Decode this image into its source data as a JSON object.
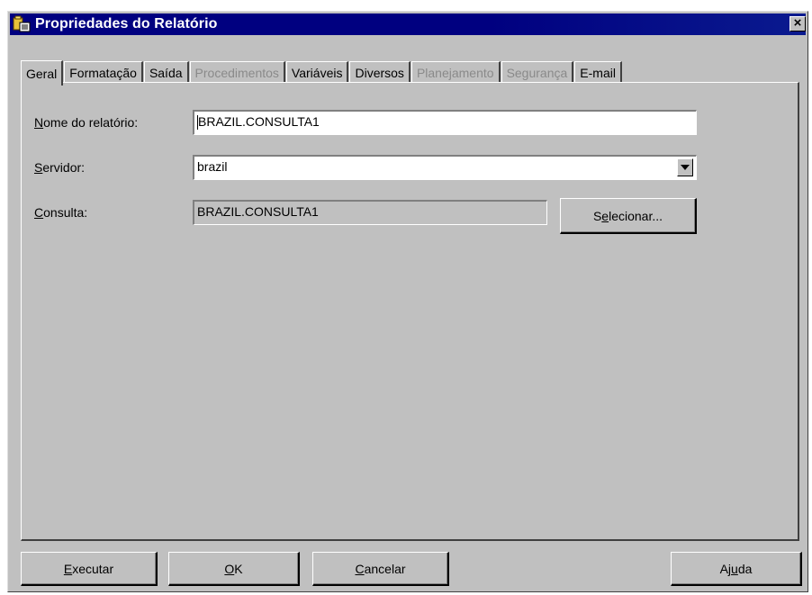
{
  "window": {
    "title": "Propriedades do Relatório",
    "close_label": "×"
  },
  "tabs": [
    {
      "label": "Geral",
      "state": "active"
    },
    {
      "label": "Formatação",
      "state": "enabled"
    },
    {
      "label": "Saída",
      "state": "enabled"
    },
    {
      "label": "Procedimentos",
      "state": "disabled"
    },
    {
      "label": "Variáveis",
      "state": "enabled"
    },
    {
      "label": "Diversos",
      "state": "enabled"
    },
    {
      "label": "Planejamento",
      "state": "disabled"
    },
    {
      "label": "Segurança",
      "state": "disabled"
    },
    {
      "label": "E-mail",
      "state": "enabled"
    }
  ],
  "form": {
    "report_name": {
      "label_accel": "N",
      "label_rest": "ome do relatório:",
      "value": "BRAZIL.CONSULTA1"
    },
    "server": {
      "label_accel": "S",
      "label_rest": "ervidor:",
      "value": "brazil"
    },
    "query": {
      "label_accel": "C",
      "label_rest": "onsulta:",
      "value": "BRAZIL.CONSULTA1"
    },
    "select_button": {
      "label_pre": "S",
      "label_accel": "e",
      "label_rest": "lecionar..."
    }
  },
  "footer": {
    "run": {
      "accel": "E",
      "rest": "xecutar"
    },
    "ok": {
      "accel": "O",
      "rest": "K"
    },
    "cancel": {
      "accel": "C",
      "rest": "ancelar"
    },
    "help": {
      "pre": "Aj",
      "accel": "u",
      "rest": "da"
    }
  },
  "colors": {
    "titlebar": "#000080",
    "face": "#c0c0c0",
    "disabled_text": "#8a8a8a"
  }
}
